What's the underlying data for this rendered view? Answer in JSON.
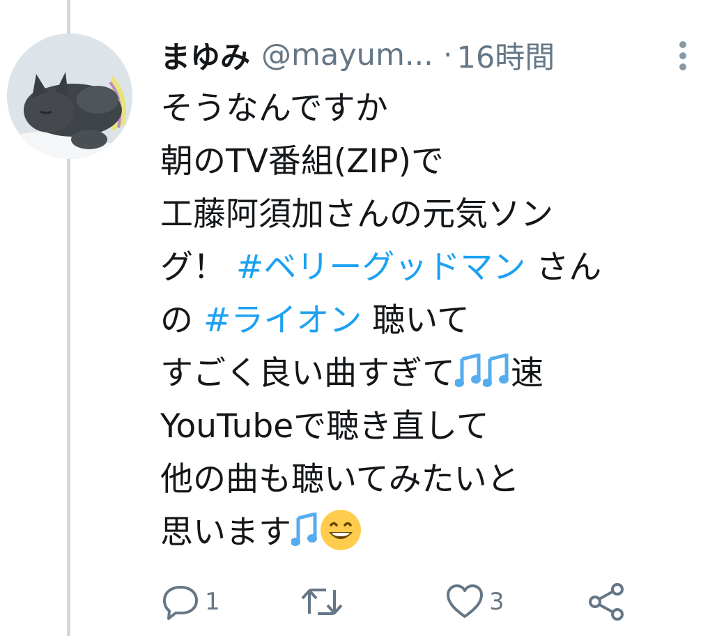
{
  "tweet": {
    "author": {
      "display_name": "まゆみ",
      "handle": "@mayum...",
      "avatar": "gray-cat-avatar"
    },
    "separator": "·",
    "time": "16時間",
    "more_icon": "more-vertical-icon",
    "lines": {
      "l1": "そうなんですか",
      "l2": "朝のTV番組(ZIP)で",
      "l3": "工藤阿須加さんの元気ソン",
      "l4_a": "グ！ ",
      "l4_hashtag": "#ベリーグッドマン",
      "l4_b": " さん",
      "l5_a": "の ",
      "l5_hashtag": "#ライオン",
      "l5_b": " 聴いて",
      "l6_a": "すごく良い曲すぎて",
      "l6_b": "速",
      "l7": "YouTubeで聴き直して",
      "l8": "他の曲も聴いてみたいと",
      "l9": "思います"
    },
    "emoji": {
      "notes": "musical-notes-emoji",
      "smile": "grinning-face-emoji"
    },
    "actions": {
      "reply_count": "1",
      "like_count": "3",
      "reply_icon": "reply-icon",
      "retweet_icon": "retweet-icon",
      "like_icon": "heart-icon",
      "share_icon": "share-icon"
    }
  },
  "colors": {
    "text": "#14171a",
    "muted": "#657786",
    "hashtag": "#1da1f2",
    "thread_line": "#cfd9de",
    "note_emoji": "#55acee",
    "smile_emoji": "#ffcc4d"
  }
}
